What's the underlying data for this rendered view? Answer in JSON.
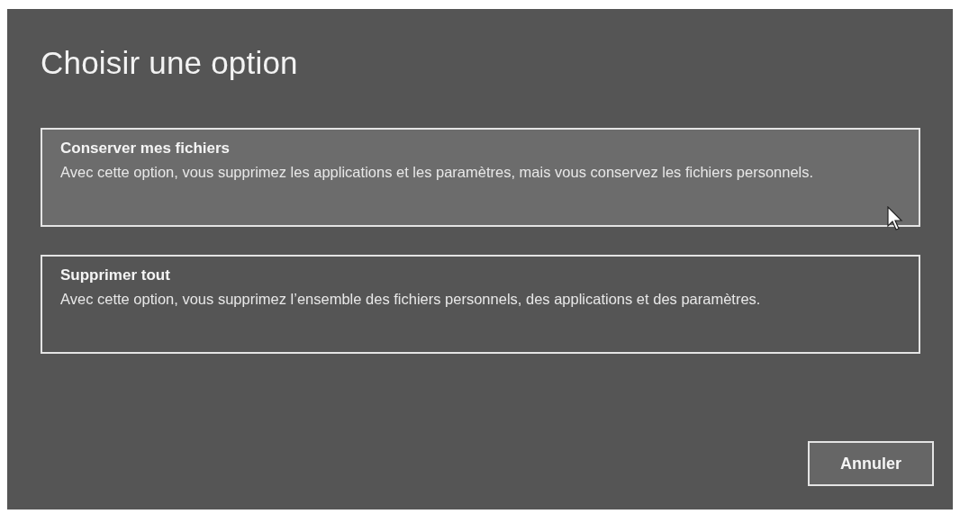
{
  "title": "Choisir une option",
  "options": [
    {
      "heading": "Conserver mes fichiers",
      "description": "Avec cette option, vous supprimez les applications et les paramètres, mais vous conservez les fichiers personnels.",
      "hovered": true
    },
    {
      "heading": "Supprimer tout",
      "description": "Avec cette option, vous supprimez l’ensemble des fichiers personnels, des applications et des paramètres.",
      "hovered": false
    }
  ],
  "buttons": [
    "Annuler"
  ]
}
